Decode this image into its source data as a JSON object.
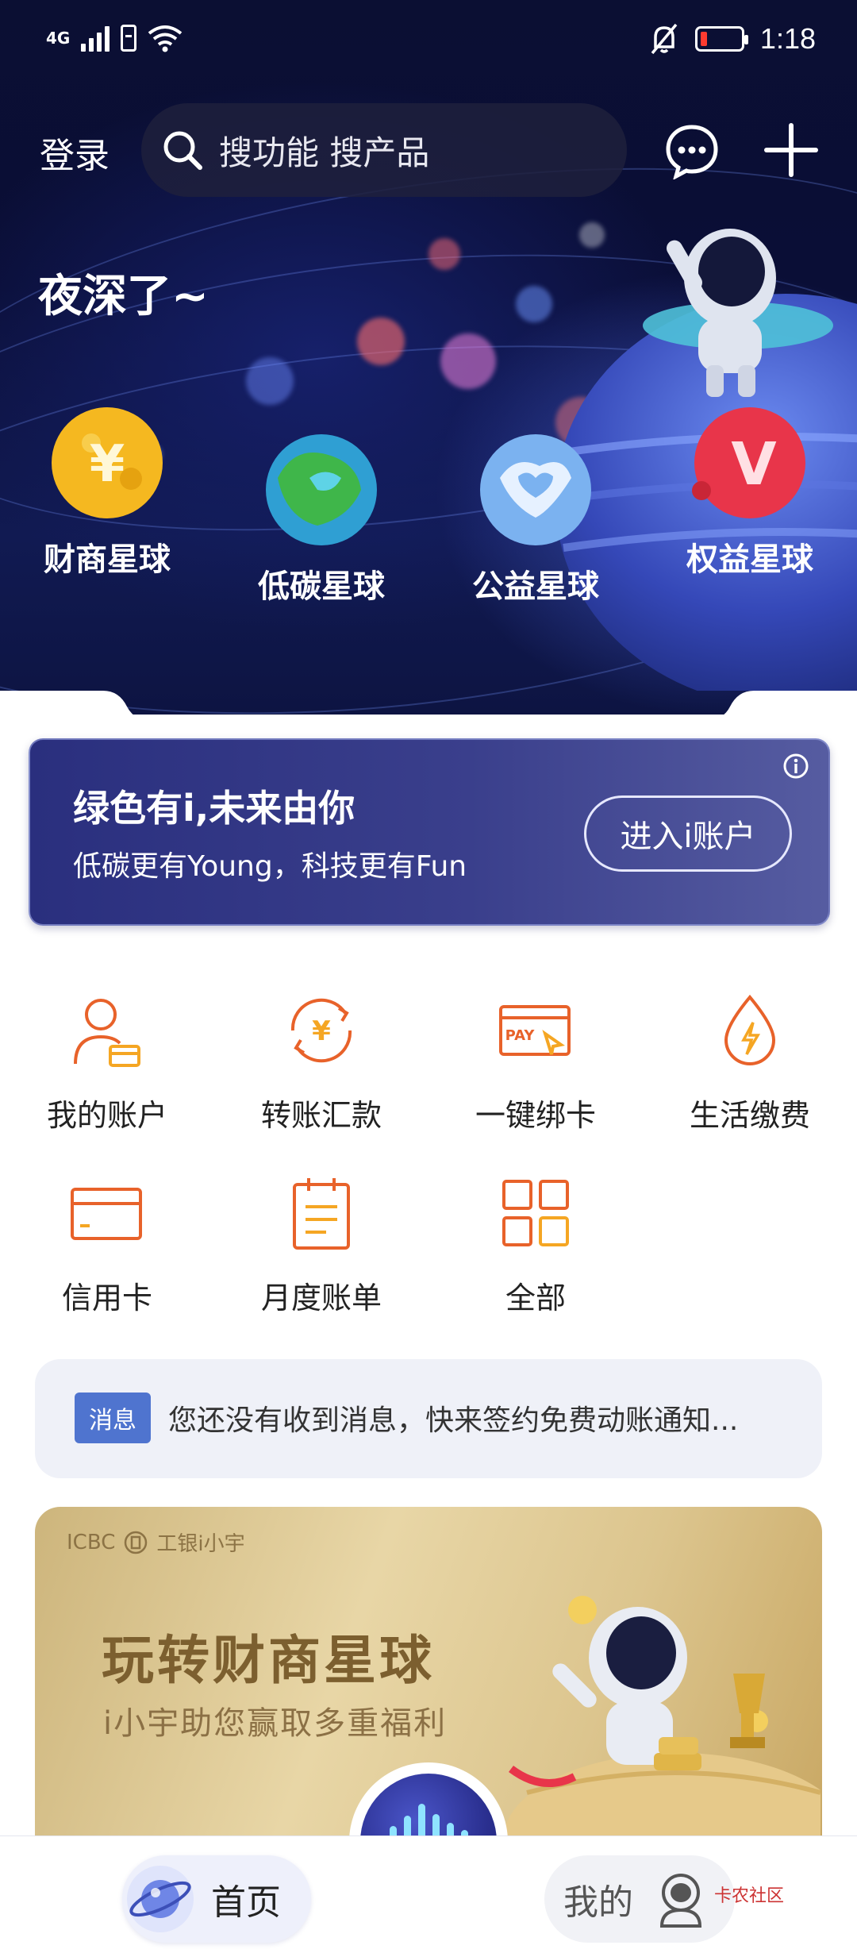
{
  "status_bar": {
    "network": "4G",
    "time": "1:18",
    "icons": [
      "signal-icon",
      "sim-icon",
      "wifi-icon",
      "mute-bell-icon",
      "battery-icon"
    ],
    "battery_level": 0.12
  },
  "header": {
    "login_label": "登录",
    "search_placeholder": "搜功能 搜产品",
    "message_icon": "chat-bubble-icon",
    "add_icon": "plus-icon"
  },
  "greeting": "夜深了~",
  "planets": [
    {
      "label": "财商星球",
      "icon": "finance-planet-icon",
      "color": "#f5b820"
    },
    {
      "label": "低碳星球",
      "icon": "lowcarbon-planet-icon",
      "color": "#3fb64a"
    },
    {
      "label": "公益星球",
      "icon": "charity-planet-icon",
      "color": "#7bb2f0"
    },
    {
      "label": "权益星球",
      "icon": "rights-planet-icon",
      "color": "#e8354a"
    }
  ],
  "banner": {
    "title": "绿色有i,未来由你",
    "subtitle": "低碳更有Young，科技更有Fun",
    "button_label": "进入i账户"
  },
  "quick_actions": [
    {
      "label": "我的账户",
      "icon": "account-icon"
    },
    {
      "label": "转账汇款",
      "icon": "transfer-icon"
    },
    {
      "label": "一键绑卡",
      "icon": "bind-card-icon"
    },
    {
      "label": "生活缴费",
      "icon": "utility-payment-icon"
    },
    {
      "label": "信用卡",
      "icon": "credit-card-icon"
    },
    {
      "label": "月度账单",
      "icon": "monthly-bill-icon"
    },
    {
      "label": "全部",
      "icon": "all-grid-icon"
    }
  ],
  "notice": {
    "badge": "消息",
    "text": "您还没有收到消息，快来签约免费动账通知..."
  },
  "promo": {
    "brand": "ICBC",
    "brand_mascot": "工银i小宇",
    "title": "玩转财商星球",
    "subtitle": "i小宇助您赢取多重福利"
  },
  "bottom_nav": {
    "home_label": "首页",
    "mine_label": "我的",
    "voice_icon": "voice-assistant-icon"
  },
  "watermark": "卡农社区",
  "colors": {
    "accent_orange": "#e8622a",
    "notice_badge": "#4f74cf",
    "hero_bg": "#0b0f33"
  }
}
